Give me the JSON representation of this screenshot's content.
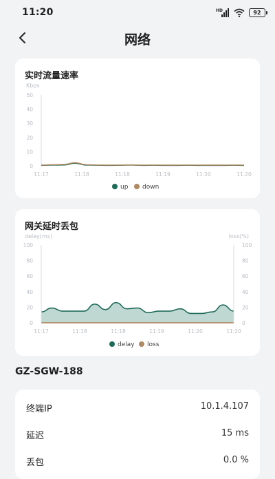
{
  "status_bar": {
    "time": "11:20",
    "network_type": "HD",
    "battery": "92"
  },
  "nav": {
    "title": "网络"
  },
  "colors": {
    "up": "#1e6b58",
    "down": "#b08a63",
    "delay": "#1e6b58",
    "delay_fill": "#bcd6d0",
    "loss": "#b08a63"
  },
  "speed_chart": {
    "title": "实时流量速率",
    "unit": "Kbps",
    "legend": [
      {
        "label": "up",
        "color": "#1e6b58"
      },
      {
        "label": "down",
        "color": "#b08a63"
      }
    ]
  },
  "gateway_chart": {
    "title": "网关延时丢包",
    "left_unit": "delay(ms)",
    "right_unit": "loss(%)",
    "legend": [
      {
        "label": "delay",
        "color": "#1e6b58"
      },
      {
        "label": "loss",
        "color": "#b08a63"
      }
    ]
  },
  "chart_data": [
    {
      "type": "area",
      "title": "实时流量速率",
      "ylabel": "Kbps",
      "ylim": [
        0,
        50
      ],
      "yticks": [
        0,
        10,
        20,
        30,
        40,
        50
      ],
      "xlim": [
        0,
        18
      ],
      "xticks": [
        0,
        3.6,
        7.2,
        10.8,
        14.4,
        18
      ],
      "xtick_labels": [
        "11:17",
        "11:18",
        "11:18",
        "11:19",
        "11:20",
        "11:20"
      ],
      "grid": false,
      "legend_position": "bottom",
      "x": [
        0,
        1,
        2,
        3,
        4,
        5,
        6,
        7,
        8,
        9,
        10,
        11,
        12,
        13,
        14,
        15,
        16,
        17,
        18
      ],
      "series": [
        {
          "name": "up",
          "values": [
            0.3,
            0.5,
            0.6,
            1.8,
            0.5,
            0.4,
            0.3,
            0.4,
            0.5,
            0.3,
            0.4,
            0.3,
            0.3,
            0.4,
            0.3,
            0.3,
            0.3,
            0.4,
            0.3
          ]
        },
        {
          "name": "down",
          "values": [
            0.5,
            0.8,
            1.0,
            2.2,
            0.8,
            0.6,
            0.5,
            0.6,
            0.7,
            0.5,
            0.6,
            0.5,
            0.5,
            0.6,
            0.5,
            0.5,
            0.5,
            0.6,
            0.5
          ]
        }
      ]
    },
    {
      "type": "area",
      "title": "网关延时丢包",
      "ylabel": "delay(ms)",
      "y2label": "loss(%)",
      "ylim": [
        0,
        100
      ],
      "y2lim": [
        0,
        100
      ],
      "yticks": [
        0,
        20,
        40,
        60,
        80,
        100
      ],
      "xlim": [
        0,
        18
      ],
      "xticks": [
        0,
        3.6,
        7.2,
        10.8,
        14.4,
        18
      ],
      "xtick_labels": [
        "11:17",
        "11:18",
        "11:18",
        "11:19",
        "11:20",
        "11:20"
      ],
      "grid": false,
      "legend_position": "bottom",
      "x": [
        0,
        1,
        2,
        3,
        4,
        5,
        6,
        7,
        8,
        9,
        10,
        11,
        12,
        13,
        14,
        15,
        16,
        17,
        18
      ],
      "series": [
        {
          "name": "delay",
          "values": [
            14,
            19,
            15,
            15,
            15,
            24,
            17,
            26,
            18,
            19,
            13,
            15,
            15,
            18,
            12,
            12,
            14,
            23,
            15
          ]
        },
        {
          "name": "loss",
          "values": [
            0,
            0,
            0,
            0,
            0,
            0,
            0,
            0,
            0,
            0,
            0,
            0,
            0,
            0,
            0,
            0,
            0,
            0,
            0
          ]
        }
      ]
    }
  ],
  "device": {
    "name": "GZ-SGW-188"
  },
  "info": [
    {
      "label": "终端IP",
      "value": "10.1.4.107"
    },
    {
      "label": "延迟",
      "value": "15 ms"
    },
    {
      "label": "丢包",
      "value": "0.0 %"
    }
  ]
}
